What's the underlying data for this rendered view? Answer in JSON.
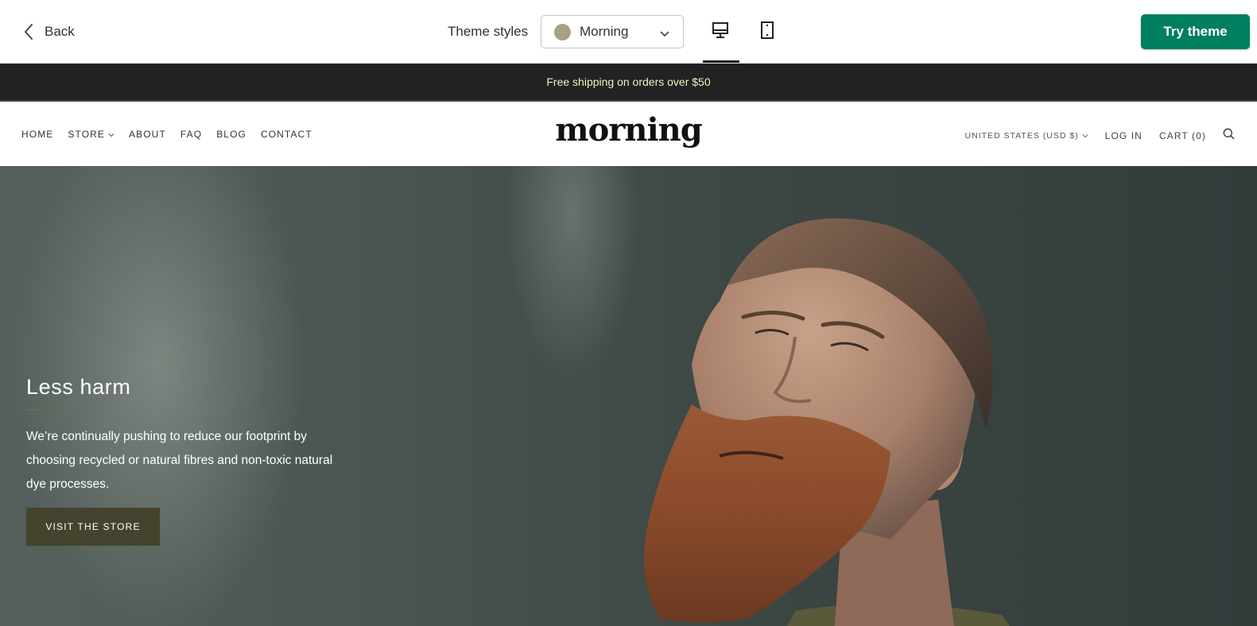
{
  "toolbar": {
    "back_label": "Back",
    "theme_styles_label": "Theme styles",
    "selected_style": "Morning",
    "selected_style_swatch": "#a8a188",
    "try_theme_label": "Try theme",
    "try_theme_color": "#008060",
    "active_device": "desktop"
  },
  "announcement": {
    "text": "Free shipping on orders over $50",
    "background": "#222222",
    "text_color": "#f5efc0"
  },
  "header": {
    "logo": "morning",
    "nav": [
      {
        "label": "HOME"
      },
      {
        "label": "STORE",
        "has_dropdown": true
      },
      {
        "label": "ABOUT"
      },
      {
        "label": "FAQ"
      },
      {
        "label": "BLOG"
      },
      {
        "label": "CONTACT"
      }
    ],
    "currency": "UNITED STATES (USD $)",
    "login": "LOG IN",
    "cart": "CART (0)"
  },
  "hero": {
    "title": "Less harm",
    "body": "We’re continually pushing to reduce our footprint by choosing recycled or natural fibres and non-toxic natural dye processes.",
    "cta_label": "VISIT THE STORE",
    "cta_color": "#45432e"
  }
}
